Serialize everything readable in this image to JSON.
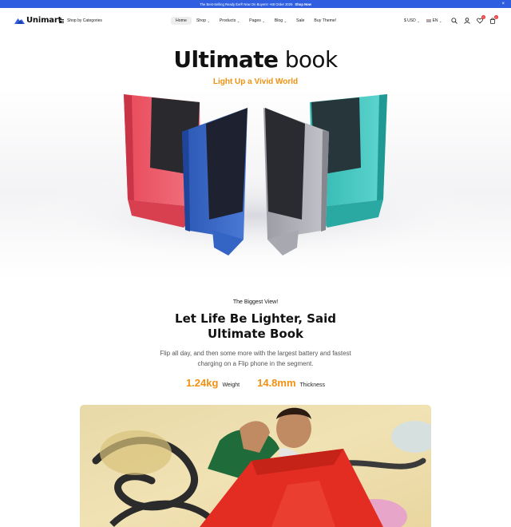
{
  "announcement": {
    "text": "The Best-Selling Ready Ibe® Now On Buyers! +68 Order 2025",
    "link": "Shop Now",
    "close": "×"
  },
  "header": {
    "logo": "Unimart",
    "categories_label": "Shop by Categories",
    "nav": [
      {
        "label": "Home",
        "caret": false
      },
      {
        "label": "Shop",
        "caret": true
      },
      {
        "label": "Products",
        "caret": true
      },
      {
        "label": "Pages",
        "caret": true
      },
      {
        "label": "Blog",
        "caret": true
      },
      {
        "label": "Sale",
        "caret": false
      },
      {
        "label": "Buy Theme!",
        "caret": false
      }
    ],
    "currency": "$ USD",
    "language": "EN",
    "wishlist_count": "0",
    "cart_count": "0",
    "icons": [
      "search-icon",
      "user-icon",
      "heart-icon",
      "cart-icon"
    ]
  },
  "hero": {
    "title_bold": "Ultimate",
    "title_light": "book",
    "subtitle": "Light Up a Vivid World",
    "image_alt": "four colorful laptops standing open",
    "colors": {
      "accent": "#f29111",
      "brand_blue": "#2f5fe0"
    }
  },
  "feature": {
    "eyebrow": "The Biggest View!",
    "title_line1": "Let Life Be Lighter, Said",
    "title_line2": "Ultimate Book",
    "desc_line1": "Flip all day, and then some more with the largest battery and fastest",
    "desc_line2": "charging on a Flip phone in the segment.",
    "spec1_value": "1.24kg",
    "spec1_label": "Weight",
    "spec2_value": "14.8mm",
    "spec2_label": "Thickness"
  }
}
